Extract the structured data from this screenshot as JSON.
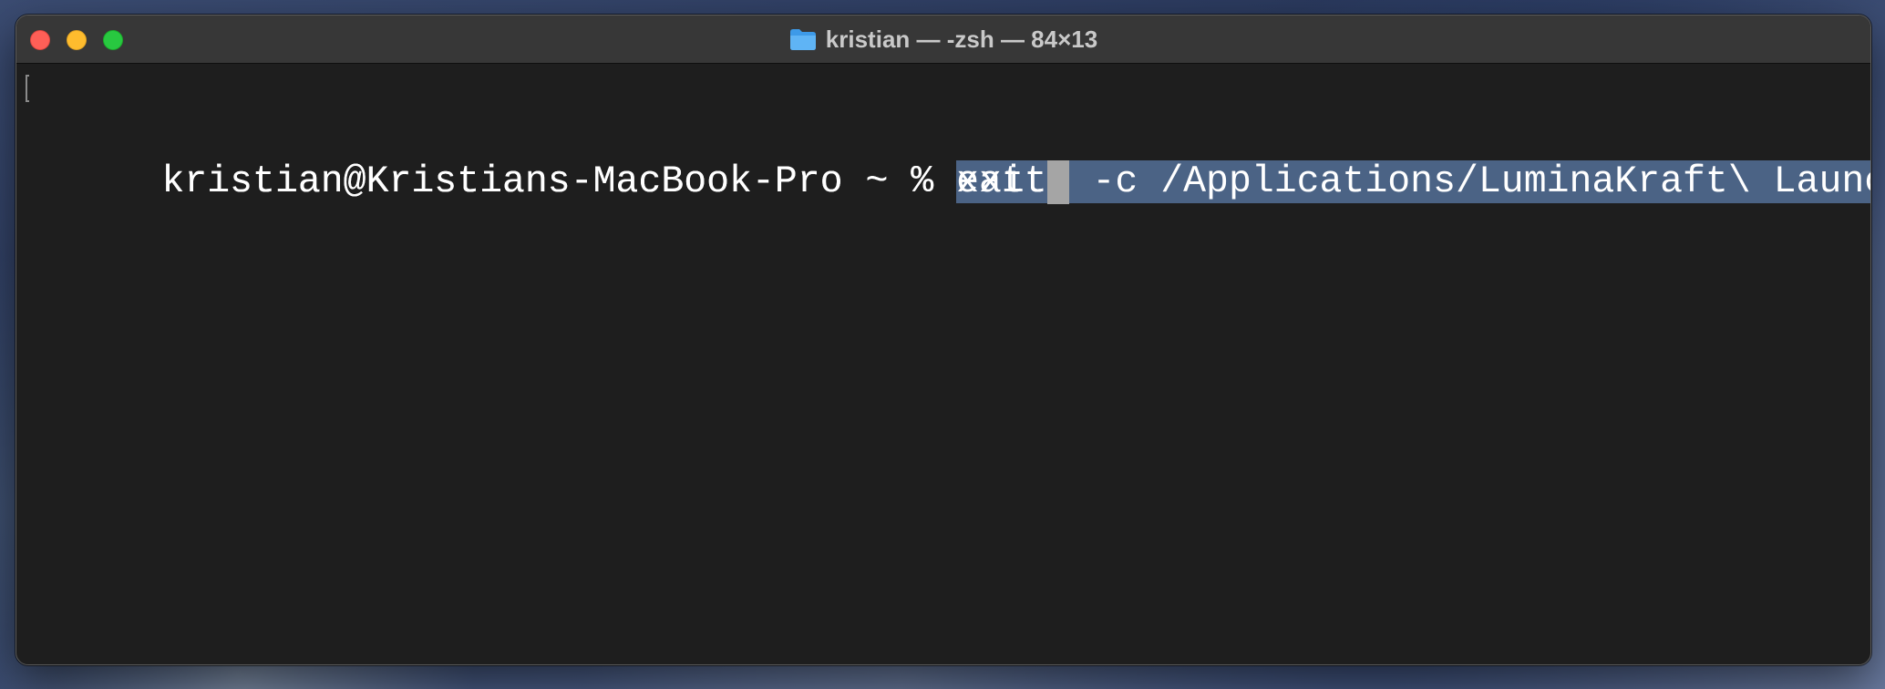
{
  "window": {
    "title": "kristian — -zsh — 84×13",
    "folder_icon": "folder-icon",
    "traffic_lights": {
      "close_color": "#fe5f57",
      "minimize_color": "#febc2e",
      "zoom_color": "#28c840"
    }
  },
  "terminal": {
    "background": "#1e1e1e",
    "selection_color": "#4b6385",
    "lines": [
      {
        "prompt": "kristian@Kristians-MacBook-Pro ~ % ",
        "command": "xattr -c /Applications/LuminaKraft\\ Launcher.app",
        "selected": true
      },
      {
        "prompt": "kristian@Kristians-MacBook-Pro ~ % ",
        "command": "exit",
        "has_cursor": true
      }
    ]
  }
}
